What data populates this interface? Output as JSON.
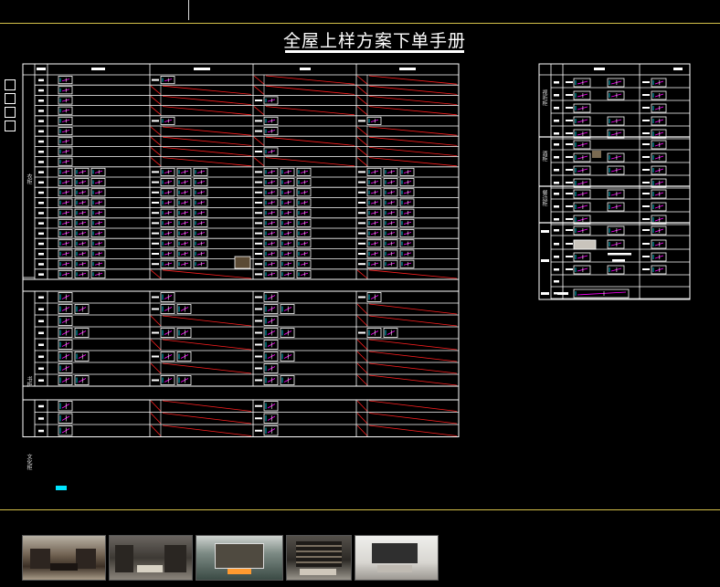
{
  "title": "全屋上样方案下单手册",
  "colors": {
    "background": "#000000",
    "frame_line": "#d6c24a",
    "grid": "#ffffff",
    "strike": "#ff2020",
    "cyan": "#00e5ff",
    "magenta": "#ff00ff"
  },
  "left_table": {
    "groups": [
      {
        "label": "衣柜",
        "rows": 20
      },
      {
        "label": "书柜",
        "rows": 8
      },
      {
        "label": "文化柜",
        "rows": 3
      }
    ]
  },
  "right_table": {
    "groups": [
      {
        "label": "视听柜"
      },
      {
        "label": "酒柜"
      },
      {
        "label": "餐边柜"
      }
    ]
  },
  "photos": [
    {
      "name": "study-room"
    },
    {
      "name": "living-room-dark"
    },
    {
      "name": "fireplace-bookshelf"
    },
    {
      "name": "library-wall"
    },
    {
      "name": "white-lounge"
    }
  ]
}
